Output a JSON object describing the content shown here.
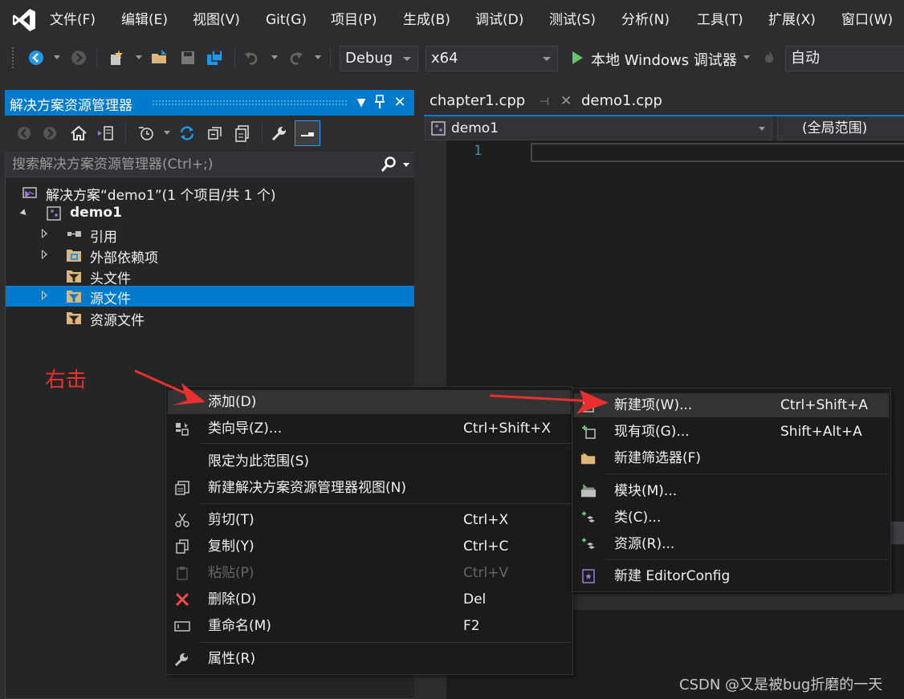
{
  "menubar": {
    "items": [
      "文件(F)",
      "编辑(E)",
      "视图(V)",
      "Git(G)",
      "项目(P)",
      "生成(B)",
      "调试(D)",
      "测试(S)",
      "分析(N)",
      "工具(T)",
      "扩展(X)",
      "窗口(W)"
    ]
  },
  "toolbar": {
    "configuration": "Debug",
    "platform": "x64",
    "debug_target": "本地 Windows 调试器",
    "auto_label": "自动"
  },
  "solution_explorer": {
    "title": "解决方案资源管理器",
    "search_placeholder": "搜索解决方案资源管理器(Ctrl+;)",
    "tree": {
      "solution": "解决方案“demo1”(1 个项目/共 1 个)",
      "project": "demo1",
      "items": [
        "引用",
        "外部依赖项",
        "头文件",
        "源文件",
        "资源文件"
      ]
    }
  },
  "editor": {
    "tabs": [
      "chapter1.cpp",
      "demo1.cpp"
    ],
    "nav_scope": "demo1",
    "nav_global": "(全局范围)",
    "line_number": "1"
  },
  "annotation": "右击",
  "context_menu": {
    "items": [
      {
        "label": "添加(D)",
        "shortcut": ""
      },
      {
        "label": "类向导(Z)...",
        "shortcut": "Ctrl+Shift+X"
      },
      {
        "label": "限定为此范围(S)",
        "shortcut": ""
      },
      {
        "label": "新建解决方案资源管理器视图(N)",
        "shortcut": ""
      },
      {
        "label": "剪切(T)",
        "shortcut": "Ctrl+X"
      },
      {
        "label": "复制(Y)",
        "shortcut": "Ctrl+C"
      },
      {
        "label": "粘贴(P)",
        "shortcut": "Ctrl+V"
      },
      {
        "label": "删除(D)",
        "shortcut": "Del"
      },
      {
        "label": "重命名(M)",
        "shortcut": "F2"
      },
      {
        "label": "属性(R)",
        "shortcut": ""
      }
    ]
  },
  "submenu": {
    "items": [
      {
        "label": "新建项(W)...",
        "shortcut": "Ctrl+Shift+A"
      },
      {
        "label": "现有项(G)...",
        "shortcut": "Shift+Alt+A"
      },
      {
        "label": "新建筛选器(F)",
        "shortcut": ""
      },
      {
        "label": "模块(M)...",
        "shortcut": ""
      },
      {
        "label": "类(C)...",
        "shortcut": ""
      },
      {
        "label": "资源(R)...",
        "shortcut": ""
      },
      {
        "label": "新建 EditorConfig",
        "shortcut": ""
      }
    ]
  },
  "watermark": "CSDN @又是被bug折磨的一天",
  "colors": {
    "accent": "#007acc",
    "background": "#2d2d30",
    "editor": "#1e1e1e",
    "annotation": "#e8312e"
  }
}
